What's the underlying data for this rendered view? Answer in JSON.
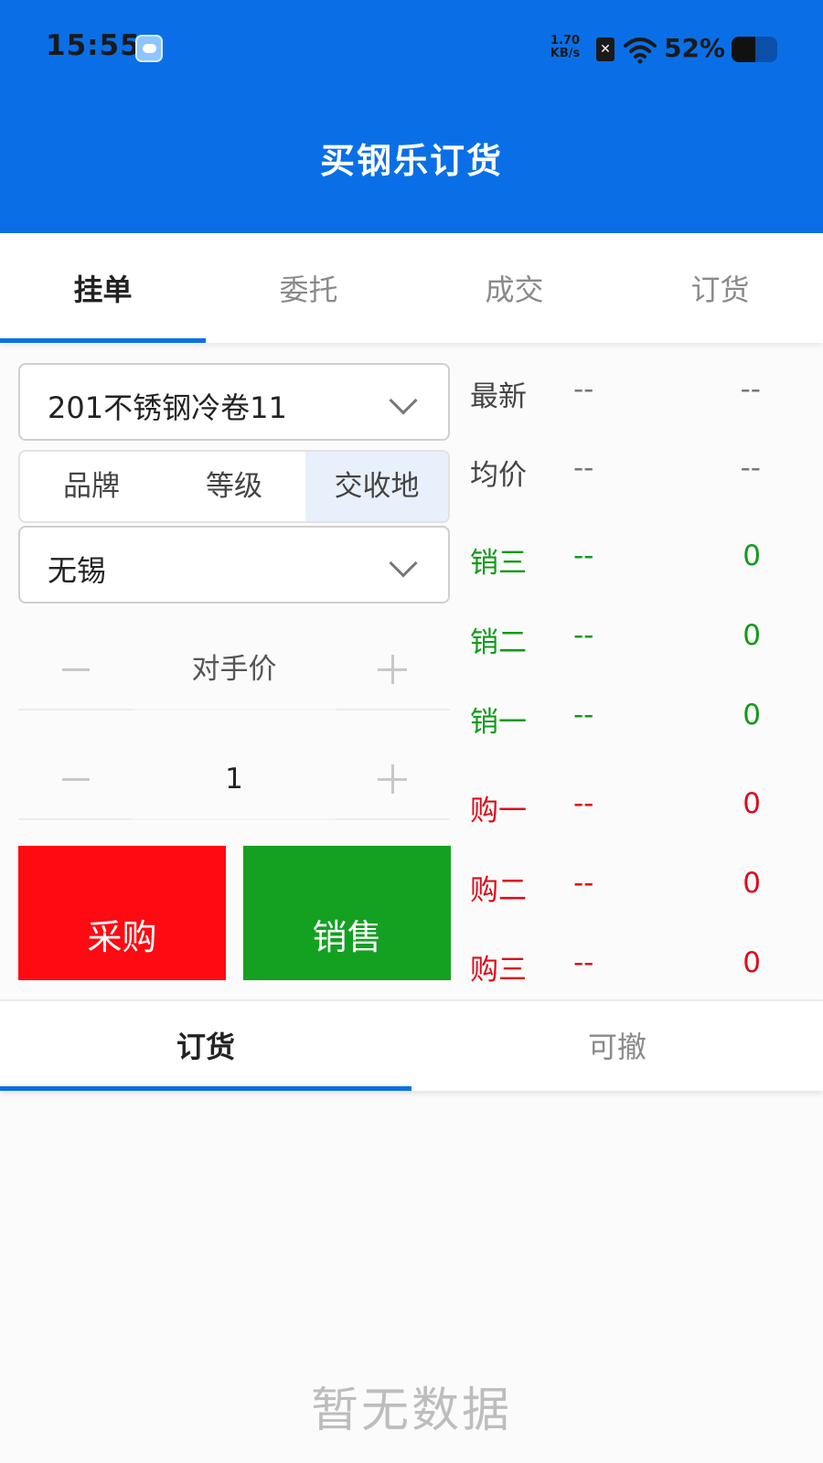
{
  "status_bar": {
    "time": "15:55",
    "speed_value": "1.70",
    "speed_unit": "KB/s",
    "battery_percent": "52%",
    "battery_level": 0.52
  },
  "header": {
    "title": "买钢乐订货"
  },
  "top_tabs": [
    {
      "label": "挂单",
      "active": true
    },
    {
      "label": "委托",
      "active": false
    },
    {
      "label": "成交",
      "active": false
    },
    {
      "label": "订货",
      "active": false
    }
  ],
  "product_select": {
    "value": "201不锈钢冷卷11"
  },
  "segments": [
    {
      "label": "品牌",
      "active": false
    },
    {
      "label": "等级",
      "active": false
    },
    {
      "label": "交收地",
      "active": true
    }
  ],
  "location_select": {
    "value": "无锡"
  },
  "price_stepper": {
    "value": "对手价"
  },
  "quantity_stepper": {
    "value": "1"
  },
  "actions": {
    "buy_label": "采购",
    "sell_label": "销售"
  },
  "market": {
    "rows": [
      {
        "label": "最新",
        "price": "--",
        "qty": "--",
        "color": "#444444"
      },
      {
        "label": "均价",
        "price": "--",
        "qty": "--",
        "color": "#444444"
      },
      {
        "label": "销三",
        "price": "--",
        "qty": "0",
        "color": "#119a19"
      },
      {
        "label": "销二",
        "price": "--",
        "qty": "0",
        "color": "#119a19"
      },
      {
        "label": "销一",
        "price": "--",
        "qty": "0",
        "color": "#119a19"
      },
      {
        "label": "购一",
        "price": "--",
        "qty": "0",
        "color": "#dd0d1a"
      },
      {
        "label": "购二",
        "price": "--",
        "qty": "0",
        "color": "#dd0d1a"
      },
      {
        "label": "购三",
        "price": "--",
        "qty": "0",
        "color": "#dd0d1a"
      }
    ]
  },
  "bottom_tabs": [
    {
      "label": "订货",
      "active": true
    },
    {
      "label": "可撤",
      "active": false
    }
  ],
  "empty_state": {
    "text": "暂无数据"
  },
  "colors": {
    "brand": "#0a6fe6",
    "buy": "#ff0a12",
    "sell": "#14a021"
  }
}
